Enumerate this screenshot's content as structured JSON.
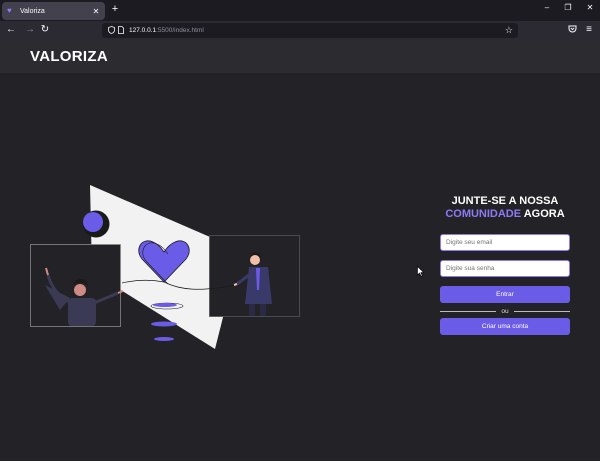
{
  "browser": {
    "tab_title": "Valoriza",
    "new_tab_label": "+",
    "url_host": "127.0.0.1",
    "url_path": ":5500/index.html"
  },
  "header": {
    "logo": "VALORIZA"
  },
  "signup": {
    "title_line1": "JUNTE-SE A NOSSA",
    "title_highlight": "COMUNIDADE",
    "title_rest": " AGORA",
    "email_placeholder": "Digite seu email",
    "password_placeholder": "Digite sua senha",
    "enter_label": "Entrar",
    "or_label": "ou",
    "create_label": "Criar uma conta"
  },
  "colors": {
    "accent": "#6b5ce7",
    "highlight": "#8b7cf6",
    "background": "#232226",
    "header": "#2c2b30"
  },
  "icons": [
    "heart-icon",
    "close-icon",
    "back-icon",
    "forward-icon",
    "reload-icon",
    "shield-icon",
    "page-icon",
    "star-icon",
    "pocket-icon",
    "menu-icon"
  ]
}
